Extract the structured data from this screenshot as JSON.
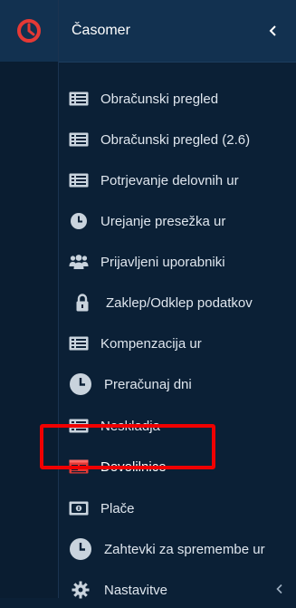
{
  "header": {
    "title": "Časomer"
  },
  "colors": {
    "accent": "#e53935",
    "highlight": "#f00000",
    "background": "#0b2036"
  },
  "menu": {
    "items": [
      {
        "label": "Obračunski pregled",
        "icon": "list-icon"
      },
      {
        "label": "Obračunski pregled (2.6)",
        "icon": "list-icon"
      },
      {
        "label": "Potrjevanje delovnih ur",
        "icon": "list-icon"
      },
      {
        "label": "Urejanje presežka ur",
        "icon": "clock-icon"
      },
      {
        "label": "Prijavljeni uporabniki",
        "icon": "users-icon"
      },
      {
        "label": "Zaklep/Odklep podatkov",
        "icon": "lock-icon"
      },
      {
        "label": "Kompenzacija ur",
        "icon": "list-icon"
      },
      {
        "label": "Preračunaj dni",
        "icon": "clock-icon"
      },
      {
        "label": "Neskladja",
        "icon": "list-icon"
      },
      {
        "label": "Dovolilnice",
        "icon": "document-icon",
        "active": true
      },
      {
        "label": "Plače",
        "icon": "money-icon"
      },
      {
        "label": "Zahtevki za spremembe ur",
        "icon": "clock-icon"
      },
      {
        "label": "Nastavitve",
        "icon": "gear-icon"
      }
    ]
  }
}
